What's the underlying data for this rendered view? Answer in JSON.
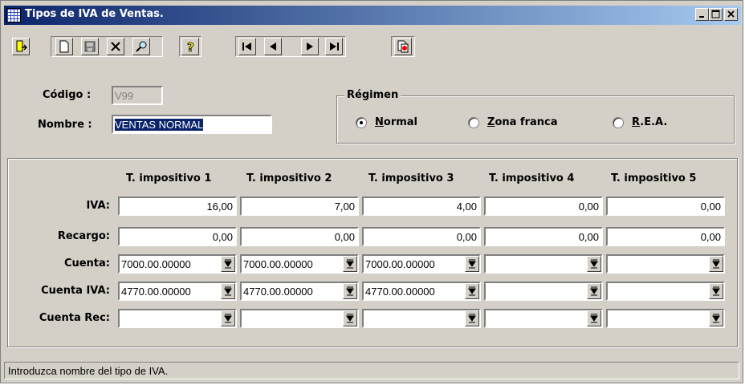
{
  "window": {
    "title": "Tipos de IVA de Ventas.",
    "controls": [
      "minimize",
      "maximize",
      "close"
    ]
  },
  "toolbar": {
    "buttons": [
      {
        "name": "exit-icon"
      },
      {
        "name": "new-icon"
      },
      {
        "name": "save-icon"
      },
      {
        "name": "delete-icon"
      },
      {
        "name": "search-icon"
      },
      {
        "name": "help-icon"
      },
      {
        "name": "first-record-icon"
      },
      {
        "name": "previous-record-icon"
      },
      {
        "name": "next-record-icon"
      },
      {
        "name": "last-record-icon"
      },
      {
        "name": "print-icon"
      }
    ]
  },
  "header": {
    "codigo_label": "Código :",
    "codigo_value": "V99",
    "nombre_label": "Nombre :",
    "nombre_value": "VENTAS NORMAL"
  },
  "regimen": {
    "title": "Régimen",
    "options": [
      {
        "accel": "N",
        "rest": "ormal",
        "selected": true
      },
      {
        "accel": "Z",
        "rest": "ona franca",
        "selected": false
      },
      {
        "accel": "R",
        "rest": ".E.A.",
        "selected": false
      }
    ]
  },
  "grid": {
    "columns": [
      "T. impositivo 1",
      "T. impositivo 2",
      "T. impositivo 3",
      "T. impositivo 4",
      "T. impositivo 5"
    ],
    "rows": {
      "iva": {
        "label": "IVA:",
        "values": [
          "16,00",
          "7,00",
          "4,00",
          "0,00",
          "0,00"
        ]
      },
      "recargo": {
        "label": "Recargo:",
        "values": [
          "0,00",
          "0,00",
          "0,00",
          "0,00",
          "0,00"
        ]
      },
      "cuenta": {
        "label": "Cuenta:",
        "values": [
          "7000.00.00000",
          "7000.00.00000",
          "7000.00.00000",
          "",
          ""
        ]
      },
      "cuenta_iva": {
        "label": "Cuenta IVA:",
        "values": [
          "4770.00.00000",
          "4770.00.00000",
          "4770.00.00000",
          "",
          ""
        ]
      },
      "cuenta_rec": {
        "label": "Cuenta Rec:",
        "values": [
          "",
          "",
          "",
          "",
          ""
        ]
      }
    }
  },
  "status": {
    "text": "Introduzca nombre del tipo de IVA."
  }
}
